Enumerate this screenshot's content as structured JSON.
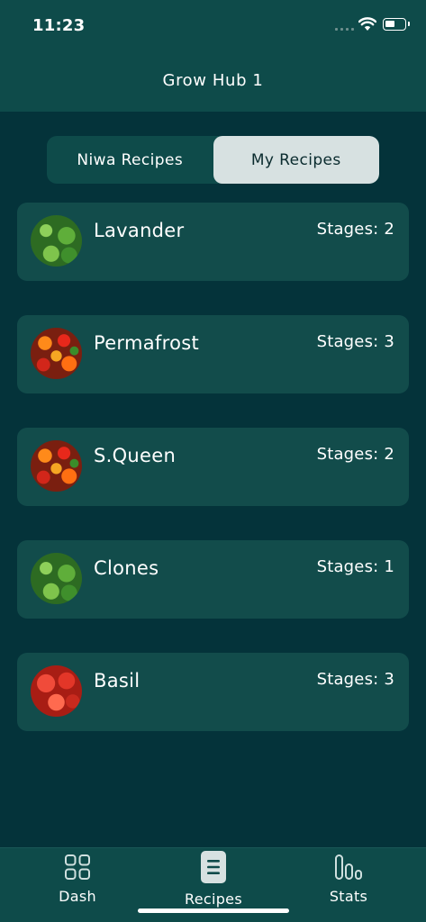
{
  "status_bar": {
    "time": "11:23"
  },
  "header": {
    "title": "Grow Hub 1"
  },
  "segmented": {
    "tabs": [
      {
        "label": "Niwa Recipes",
        "active": false
      },
      {
        "label": "My Recipes",
        "active": true
      }
    ]
  },
  "recipes": [
    {
      "name": "Lavander",
      "stages": "Stages: 2",
      "thumbnail": "lettuce-icon"
    },
    {
      "name": "Permafrost",
      "stages": "Stages: 3",
      "thumbnail": "peppers-icon"
    },
    {
      "name": "S.Queen",
      "stages": "Stages: 2",
      "thumbnail": "peppers-icon"
    },
    {
      "name": "Clones",
      "stages": "Stages: 1",
      "thumbnail": "lettuce-icon"
    },
    {
      "name": "Basil",
      "stages": "Stages: 3",
      "thumbnail": "tomatoes-icon"
    }
  ],
  "tab_bar": {
    "items": [
      {
        "label": "Dash",
        "icon": "grid-icon",
        "active": false
      },
      {
        "label": "Recipes",
        "icon": "document-icon",
        "active": true
      },
      {
        "label": "Stats",
        "icon": "bar-chart-icon",
        "active": false
      }
    ]
  },
  "colors": {
    "background": "#04333a",
    "header": "#0e4b4a",
    "card": "#124c4b",
    "segment_active": "#d7e1e1",
    "text": "#ffffff"
  }
}
